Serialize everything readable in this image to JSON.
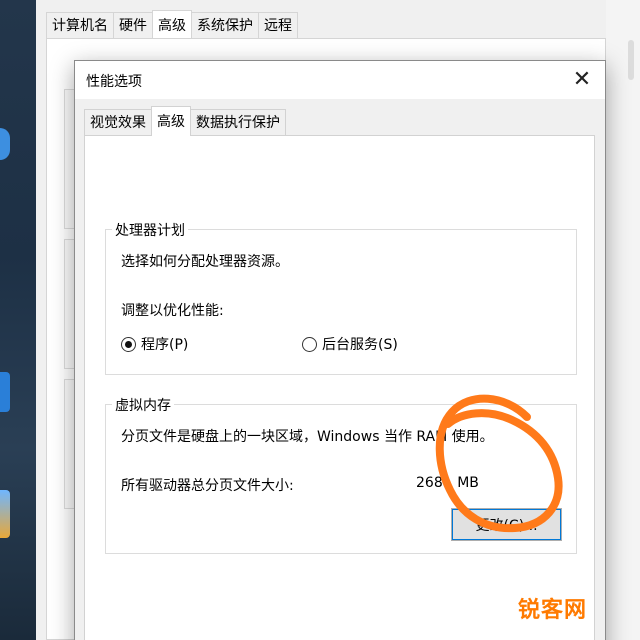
{
  "background_window": {
    "tabs": [
      "计算机名",
      "硬件",
      "高级",
      "系统保护",
      "远程"
    ],
    "active_tab": "高级"
  },
  "dialog": {
    "title": "性能选项",
    "close_glyph": "✕",
    "tabs": [
      "视觉效果",
      "高级",
      "数据执行保护"
    ],
    "active_tab": "高级",
    "processor": {
      "legend": "处理器计划",
      "description": "选择如何分配处理器资源。",
      "adjust_label": "调整以优化性能:",
      "options": [
        {
          "label": "程序(P)",
          "selected": true
        },
        {
          "label": "后台服务(S)",
          "selected": false
        }
      ]
    },
    "virtual_memory": {
      "legend": "虚拟内存",
      "description": "分页文件是硬盘上的一块区域，Windows 当作 RAM 使用。",
      "total_label": "所有驱动器总分页文件大小:",
      "total_value": "268",
      "total_unit": "MB",
      "change_button": "更改(C)..."
    }
  },
  "annotation": {
    "color": "#ff7a1a"
  },
  "watermark": "锐客网"
}
